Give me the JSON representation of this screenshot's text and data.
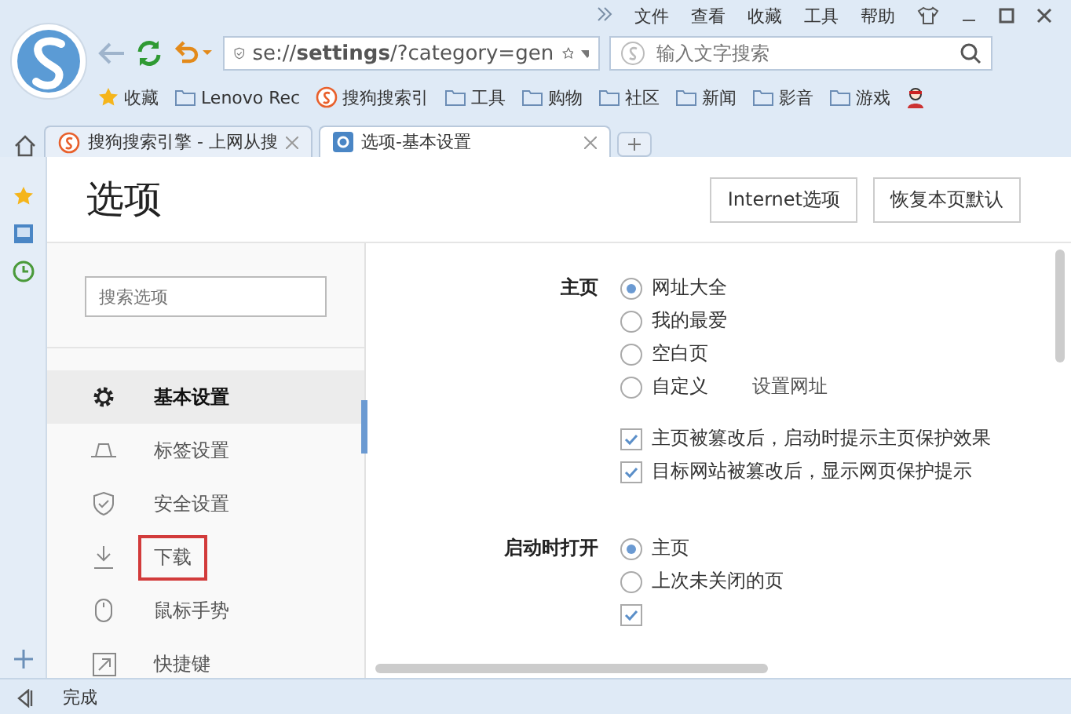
{
  "menu": [
    "文件",
    "查看",
    "收藏",
    "工具",
    "帮助"
  ],
  "address": {
    "value": "se://**settings**/?category=gen"
  },
  "search": {
    "placeholder": "输入文字搜索"
  },
  "bookmarks": [
    {
      "label": "收藏",
      "kind": "star"
    },
    {
      "label": "Lenovo Rec",
      "kind": "folder"
    },
    {
      "label": "搜狗搜索引",
      "kind": "site"
    },
    {
      "label": "工具",
      "kind": "folder"
    },
    {
      "label": "购物",
      "kind": "folder"
    },
    {
      "label": "社区",
      "kind": "folder"
    },
    {
      "label": "新闻",
      "kind": "folder"
    },
    {
      "label": "影音",
      "kind": "folder"
    },
    {
      "label": "游戏",
      "kind": "folder"
    }
  ],
  "tabs": [
    {
      "label": "搜狗搜索引擎 - 上网从搜",
      "selected": false
    },
    {
      "label": "选项-基本设置",
      "selected": true
    }
  ],
  "page": {
    "title": "选项",
    "buttons": [
      "Internet选项",
      "恢复本页默认"
    ],
    "search": {
      "placeholder": "搜索选项"
    }
  },
  "nav": [
    {
      "label": "基本设置",
      "selected": true,
      "highlighted": false
    },
    {
      "label": "标签设置",
      "selected": false,
      "highlighted": false
    },
    {
      "label": "安全设置",
      "selected": false,
      "highlighted": false
    },
    {
      "label": "下载",
      "selected": false,
      "highlighted": true
    },
    {
      "label": "鼠标手势",
      "selected": false,
      "highlighted": false
    },
    {
      "label": "快捷键",
      "selected": false,
      "highlighted": false
    }
  ],
  "sections": [
    {
      "label": "主页",
      "options": [
        {
          "kind": "radio",
          "label": "网址大全",
          "checked": true
        },
        {
          "kind": "radio",
          "label": "我的最爱",
          "checked": false
        },
        {
          "kind": "radio",
          "label": "空白页",
          "checked": false
        },
        {
          "kind": "radio",
          "label": "自定义",
          "checked": false,
          "link": "设置网址"
        },
        {
          "kind": "gap"
        },
        {
          "kind": "checkbox",
          "label": "主页被篡改后，启动时提示主页保护效果",
          "checked": true
        },
        {
          "kind": "checkbox",
          "label": "目标网站被篡改后，显示网页保护提示",
          "checked": true
        }
      ]
    },
    {
      "label": "启动时打开",
      "options": [
        {
          "kind": "radio",
          "label": "主页",
          "checked": true
        },
        {
          "kind": "radio",
          "label": "上次未关闭的页",
          "checked": false
        },
        {
          "kind": "checkbox",
          "checked": true
        }
      ]
    }
  ],
  "status": "完成"
}
